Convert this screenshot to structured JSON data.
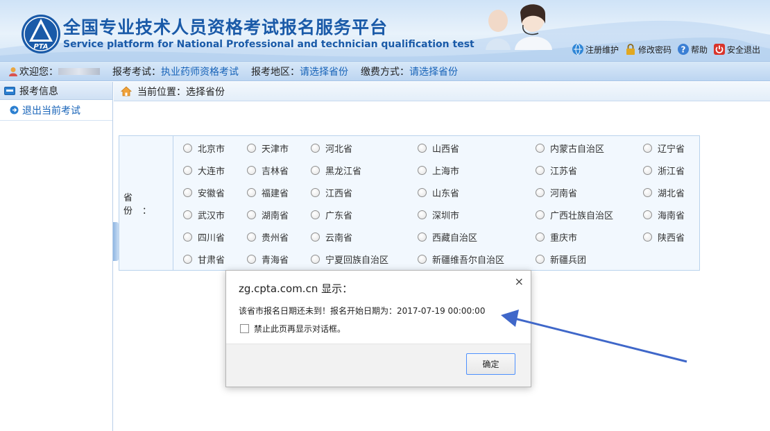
{
  "header": {
    "title_cn": "全国专业技术人员资格考试报名服务平台",
    "title_en": "Service platform for National Professional and technician qualification test",
    "logo_text": "PTA",
    "links": [
      {
        "label": "注册维护",
        "icon": "globe-icon"
      },
      {
        "label": "修改密码",
        "icon": "lock-icon"
      },
      {
        "label": "帮助",
        "icon": "help-icon"
      },
      {
        "label": "安全退出",
        "icon": "power-icon"
      }
    ]
  },
  "infobar": {
    "welcome_label": "欢迎您：",
    "exam_label": "报考考试：",
    "exam_value": "执业药师资格考试",
    "region_label": "报考地区：",
    "region_value": "请选择省份",
    "payment_label": "缴费方式：",
    "payment_value": "请选择省份"
  },
  "sidebar": {
    "header": "报考信息",
    "items": [
      {
        "label": "退出当前考试"
      }
    ]
  },
  "location": {
    "label": "当前位置：选择省份"
  },
  "provinces": {
    "label": "省份：",
    "rows": [
      [
        "北京市",
        "天津市",
        "河北省",
        "山西省",
        "内蒙古自治区",
        "辽宁省"
      ],
      [
        "大连市",
        "吉林省",
        "黑龙江省",
        "上海市",
        "江苏省",
        "浙江省"
      ],
      [
        "安徽省",
        "福建省",
        "江西省",
        "山东省",
        "河南省",
        "湖北省"
      ],
      [
        "武汉市",
        "湖南省",
        "广东省",
        "深圳市",
        "广西壮族自治区",
        "海南省"
      ],
      [
        "四川省",
        "贵州省",
        "云南省",
        "西藏自治区",
        "重庆市",
        "陕西省"
      ],
      [
        "甘肃省",
        "青海省",
        "宁夏回族自治区",
        "新疆维吾尔自治区",
        "新疆兵团"
      ]
    ]
  },
  "dialog": {
    "title": "zg.cpta.com.cn 显示：",
    "close": "×",
    "message": "该省市报名日期还未到！报名开始日期为：2017-07-19 00:00:00",
    "checkbox_label": "禁止此页再显示对话框。",
    "ok_label": "确定"
  },
  "colors": {
    "brand": "#1a5aa8",
    "link": "#1763b8",
    "arrow": "#3f67c9"
  }
}
